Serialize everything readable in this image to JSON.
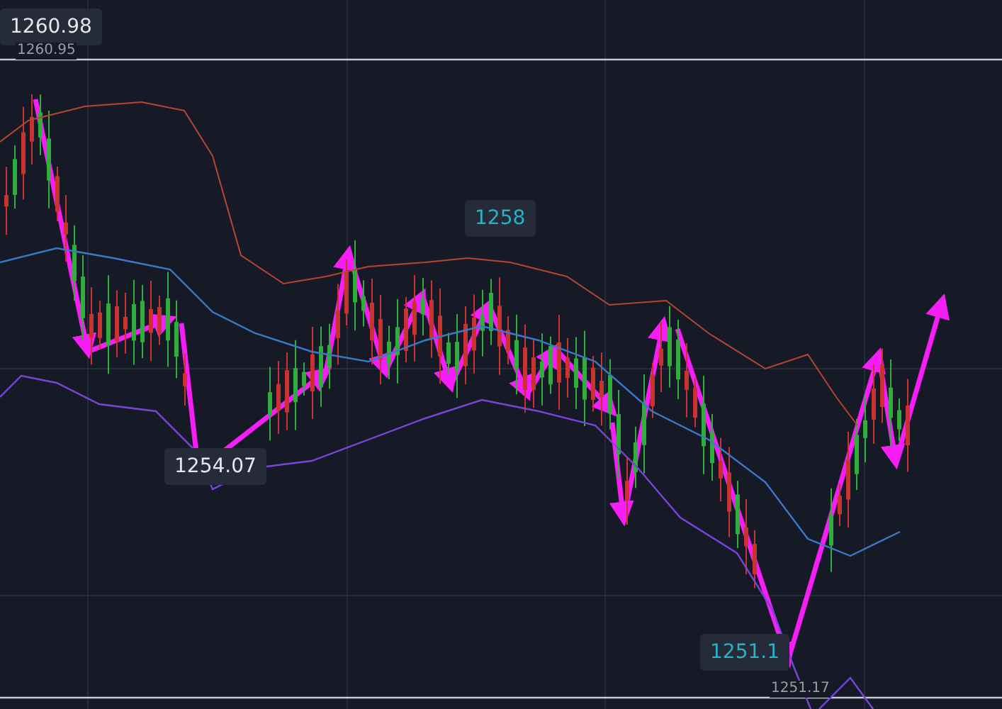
{
  "chart": {
    "labels": [
      {
        "text": "1260.98",
        "kind": "box",
        "color": "#e4e6ea"
      },
      {
        "text": "1260.95",
        "kind": "plain",
        "color": "#9a9da6"
      },
      {
        "text": "1258",
        "kind": "box",
        "color": "#2bb0c4"
      },
      {
        "text": "1254.07",
        "kind": "box",
        "color": "#e4e6ea"
      },
      {
        "text": "1251.1",
        "kind": "box",
        "color": "#2bb0c4"
      },
      {
        "text": "1251.17",
        "kind": "plain",
        "color": "#9a9da6"
      }
    ]
  }
}
